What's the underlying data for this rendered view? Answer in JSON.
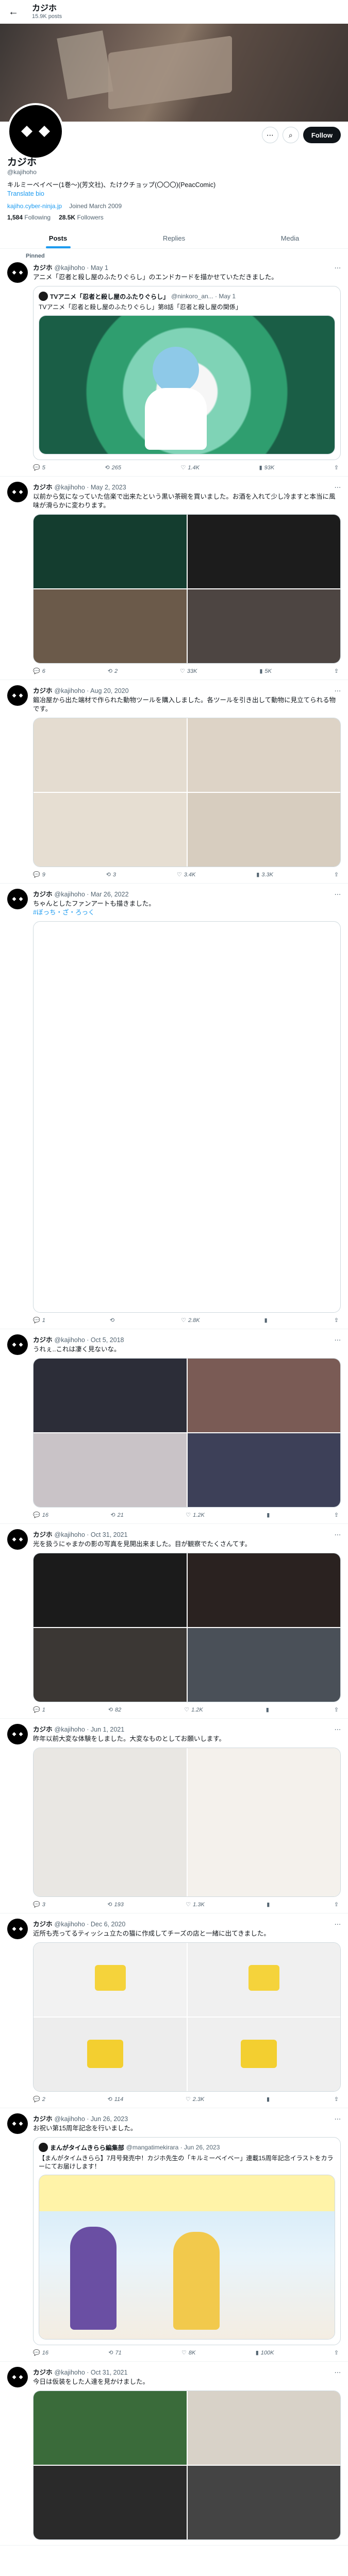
{
  "header": {
    "title": "カジホ",
    "subtitle": "15.9K posts"
  },
  "profile": {
    "name": "カジホ",
    "handle": "@kajihoho",
    "bio": "キルミーベイベー(1巻〜)(芳文社)、たけクチョップ(〇〇〇)(PeacComic)",
    "bio_link": "Translate bio",
    "website": "kajiho.cyber-ninja.jp",
    "joined": "Joined March 2009",
    "following_count": "1,584",
    "following_label": "Following",
    "followers_count": "28.5K",
    "followers_label": "Followers",
    "follow_label": "Follow"
  },
  "tabs": [
    {
      "label": "Posts"
    },
    {
      "label": "Replies"
    },
    {
      "label": "Media"
    }
  ],
  "pinned_label": "Pinned",
  "tweets": [
    {
      "name": "カジホ",
      "handle": "@kajihoho · May 1",
      "text": "アニメ「忍者と殺し屋のふたりぐらし」のエンドカードを描かせていただきました。",
      "quote": {
        "name": "TVアニメ「忍者と殺し屋のふたりぐらし」",
        "handle": "@ninkoro_an... · May 1",
        "text": "TVアニメ「忍者と殺し屋のふたりぐらし」第8話「忍者と殺し屋の関係」"
      },
      "stats": {
        "reply": "5",
        "retweet": "265",
        "like": "1.4K",
        "views": "93K"
      }
    },
    {
      "name": "カジホ",
      "handle": "@kajihoho · May 2, 2023",
      "text": "以前から気になっていた信楽で出来たという黒い茶碗を買いました。お酒を入れて少し冷ますと本当に風味が滑らかに変わります。",
      "stats": {
        "reply": "6",
        "retweet": "2",
        "like": "33K",
        "views": "5K"
      }
    },
    {
      "name": "カジホ",
      "handle": "@kajihoho · Aug 20, 2020",
      "text": "鍛冶屋から出た端材で作られた動物ツールを購入しました。各ツールを引き出して動物に見立てられる物です。",
      "stats": {
        "reply": "9",
        "retweet": "3",
        "like": "3.4K",
        "views": "3.3K"
      }
    },
    {
      "name": "カジホ",
      "handle": "@kajihoho · Mar 26, 2022",
      "text": "ちゃんとしたファンアートも描きました。",
      "hash": "#ぼっち・ざ・ろっく",
      "stats": {
        "reply": "1",
        "retweet": "",
        "like": "2.8K",
        "views": ""
      }
    },
    {
      "name": "カジホ",
      "handle": "@kajihoho · Oct 5, 2018",
      "text": "うれぇ..これは凄く見ないな。",
      "stats": {
        "reply": "16",
        "retweet": "21",
        "like": "1.2K",
        "views": ""
      }
    },
    {
      "name": "カジホ",
      "handle": "@kajihoho · Oct 31, 2021",
      "text": "光を扱うにゃまかの影の写真を見開出来ました。目が観察でたくさんてす。",
      "stats": {
        "reply": "1",
        "retweet": "82",
        "like": "1.2K",
        "views": ""
      }
    },
    {
      "name": "カジホ",
      "handle": "@kajihoho · Jun 1, 2021",
      "text": "昨年以前大変な体験をしました。大変なものとしてお願いします。",
      "stats": {
        "reply": "3",
        "retweet": "193",
        "like": "1.3K",
        "views": ""
      }
    },
    {
      "name": "カジホ",
      "handle": "@kajihoho · Dec 6, 2020",
      "text": "近所も売ってるティッシュ立たの猫に作成してチーズの店と一緒に出てきました。",
      "stats": {
        "reply": "2",
        "retweet": "114",
        "like": "2.3K",
        "views": ""
      }
    },
    {
      "name": "カジホ",
      "handle": "@kajihoho · Jun 26, 2023",
      "text": "お祝い第15周年記念を行いました。",
      "quote": {
        "name": "まんがタイムきらら編集部",
        "handle": "@mangatimekirara · Jun 26, 2023",
        "text": "【まんがタイムきらら】7月号発売中！カジホ先生の「キルミーベイベー」連載15周年記念イラストをカラーにてお届けします！"
      },
      "stats": {
        "reply": "16",
        "retweet": "71",
        "like": "8K",
        "views": "100K"
      }
    },
    {
      "name": "カジホ",
      "handle": "@kajihoho · Oct 31, 2021",
      "text": "今日は仮装をした人達を見かけました。",
      "stats": {
        "reply": "",
        "retweet": "",
        "like": "",
        "views": ""
      }
    }
  ]
}
